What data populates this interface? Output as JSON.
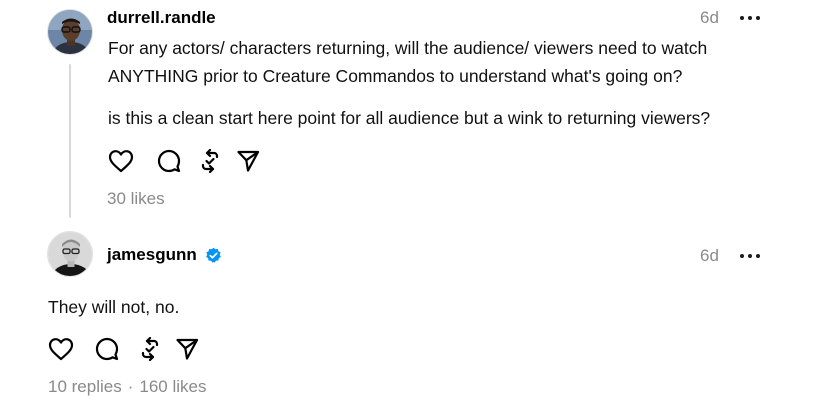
{
  "posts": [
    {
      "username": "durrell.randle",
      "time": "6d",
      "verified": false,
      "paragraphs": [
        "For any actors/ characters returning, will the audience/ viewers need to watch",
        "ANYTHING prior to Creature Commandos to understand what's going on?",
        "is this a clean start here point for all audience but a wink to returning viewers?"
      ],
      "likes": "30 likes"
    },
    {
      "username": "jamesgunn",
      "time": "6d",
      "verified": true,
      "text": "They will not, no.",
      "replies": "10 replies",
      "separator": "·",
      "likes": "160 likes"
    }
  ],
  "icons": {
    "like": "heart-icon",
    "comment": "comment-icon",
    "repost": "repost-icon",
    "share": "send-icon",
    "more": "more-icon",
    "verified": "verified-badge-icon"
  },
  "colors": {
    "text": "#000000",
    "muted": "#8a8a8a",
    "verified": "#0095f6",
    "thread_line": "#d9d9d9"
  }
}
